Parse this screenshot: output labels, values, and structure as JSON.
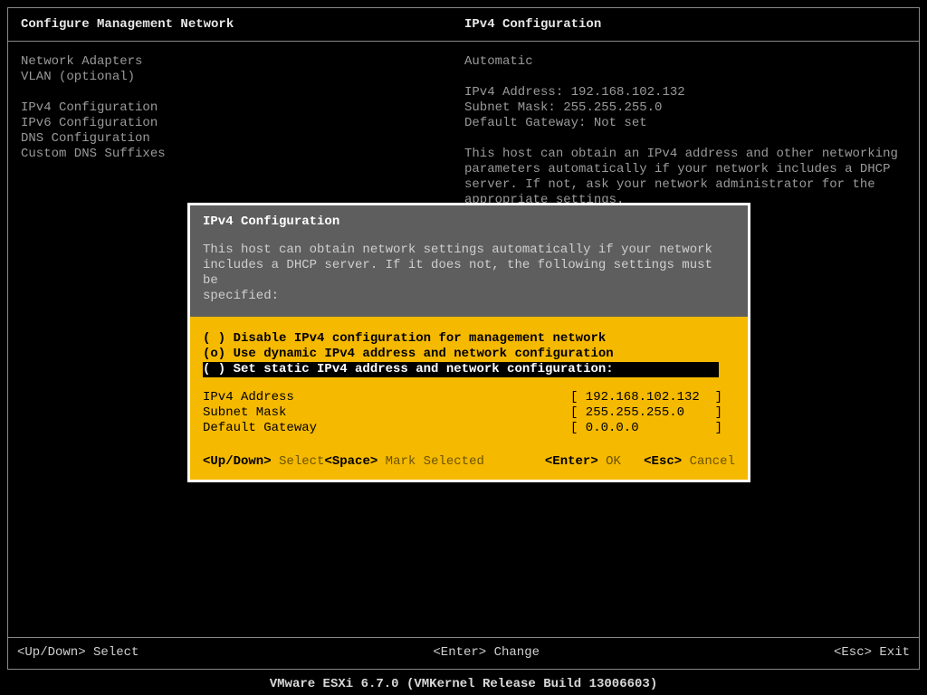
{
  "header": {
    "left": "Configure Management Network",
    "right": "IPv4 Configuration"
  },
  "menu": {
    "items1": [
      "Network Adapters",
      "VLAN (optional)"
    ],
    "items2": [
      "IPv4 Configuration",
      "IPv6 Configuration",
      "DNS Configuration",
      "Custom DNS Suffixes"
    ]
  },
  "info": {
    "mode": "Automatic",
    "ipv4_label": "IPv4 Address:",
    "ipv4": "192.168.102.132",
    "mask_label": "Subnet Mask:",
    "mask": "255.255.255.0",
    "gw_label": "Default Gateway:",
    "gw": "Not set",
    "desc_l1": "This host can obtain an IPv4 address and other networking",
    "desc_l2": "parameters automatically if your network includes a DHCP",
    "desc_l3": "server. If not, ask your network administrator for the",
    "desc_l4": "appropriate settings."
  },
  "footer": {
    "left": "<Up/Down> Select",
    "center": "<Enter> Change",
    "right": "<Esc> Exit"
  },
  "product": "VMware ESXi 6.7.0 (VMKernel Release Build 13006603)",
  "dialog": {
    "title": "IPv4 Configuration",
    "desc_l1": "This host can obtain network settings automatically if your network",
    "desc_l2": "includes a DHCP server. If it does not, the following settings must be",
    "desc_l3": "specified:",
    "opt1": "( ) Disable IPv4 configuration for management network",
    "opt2": "(o) Use dynamic IPv4 address and network configuration",
    "opt3": "( ) Set static IPv4 address and network configuration:",
    "field_ip_label": "IPv4 Address",
    "field_ip_value": "[ 192.168.102.132  ]",
    "field_mask_label": "Subnet Mask",
    "field_mask_value": "[ 255.255.255.0    ]",
    "field_gw_label": "Default Gateway",
    "field_gw_value": "[ 0.0.0.0          ]",
    "hint_updown_key": "<Up/Down>",
    "hint_updown_label": "Select",
    "hint_space_key": "<Space>",
    "hint_space_label": "Mark Selected",
    "hint_enter_key": "<Enter>",
    "hint_enter_label": "OK",
    "hint_esc_key": "<Esc>",
    "hint_esc_label": "Cancel"
  }
}
